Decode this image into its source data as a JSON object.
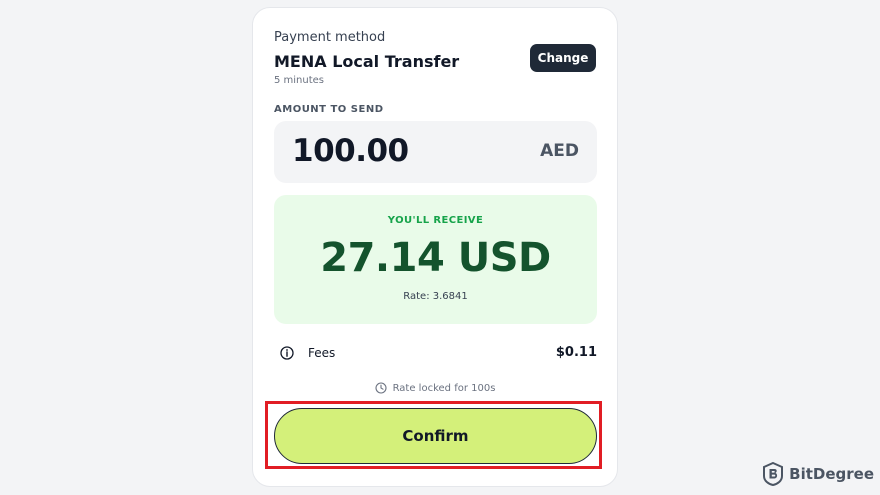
{
  "payment": {
    "label": "Payment method",
    "name": "MENA Local Transfer",
    "eta": "5 minutes",
    "change_label": "Change"
  },
  "amount": {
    "label": "AMOUNT TO SEND",
    "value": "100.00",
    "currency": "AED"
  },
  "receive": {
    "label": "YOU'LL RECEIVE",
    "amount": "27.14 USD",
    "rate": "Rate: 3.6841"
  },
  "fees": {
    "label": "Fees",
    "value": "$0.11",
    "icon": "info-icon"
  },
  "rate_lock": {
    "text": "Rate locked for 100s",
    "icon": "clock-icon"
  },
  "confirm_label": "Confirm",
  "watermark": {
    "text": "BitDegree"
  },
  "colors": {
    "accent_button": "#d4f07a",
    "receive_bg": "#e9fbe9",
    "receive_text": "#14532d",
    "receive_label": "#16a34a",
    "highlight": "#e11d24",
    "change_button": "#1f2937"
  }
}
